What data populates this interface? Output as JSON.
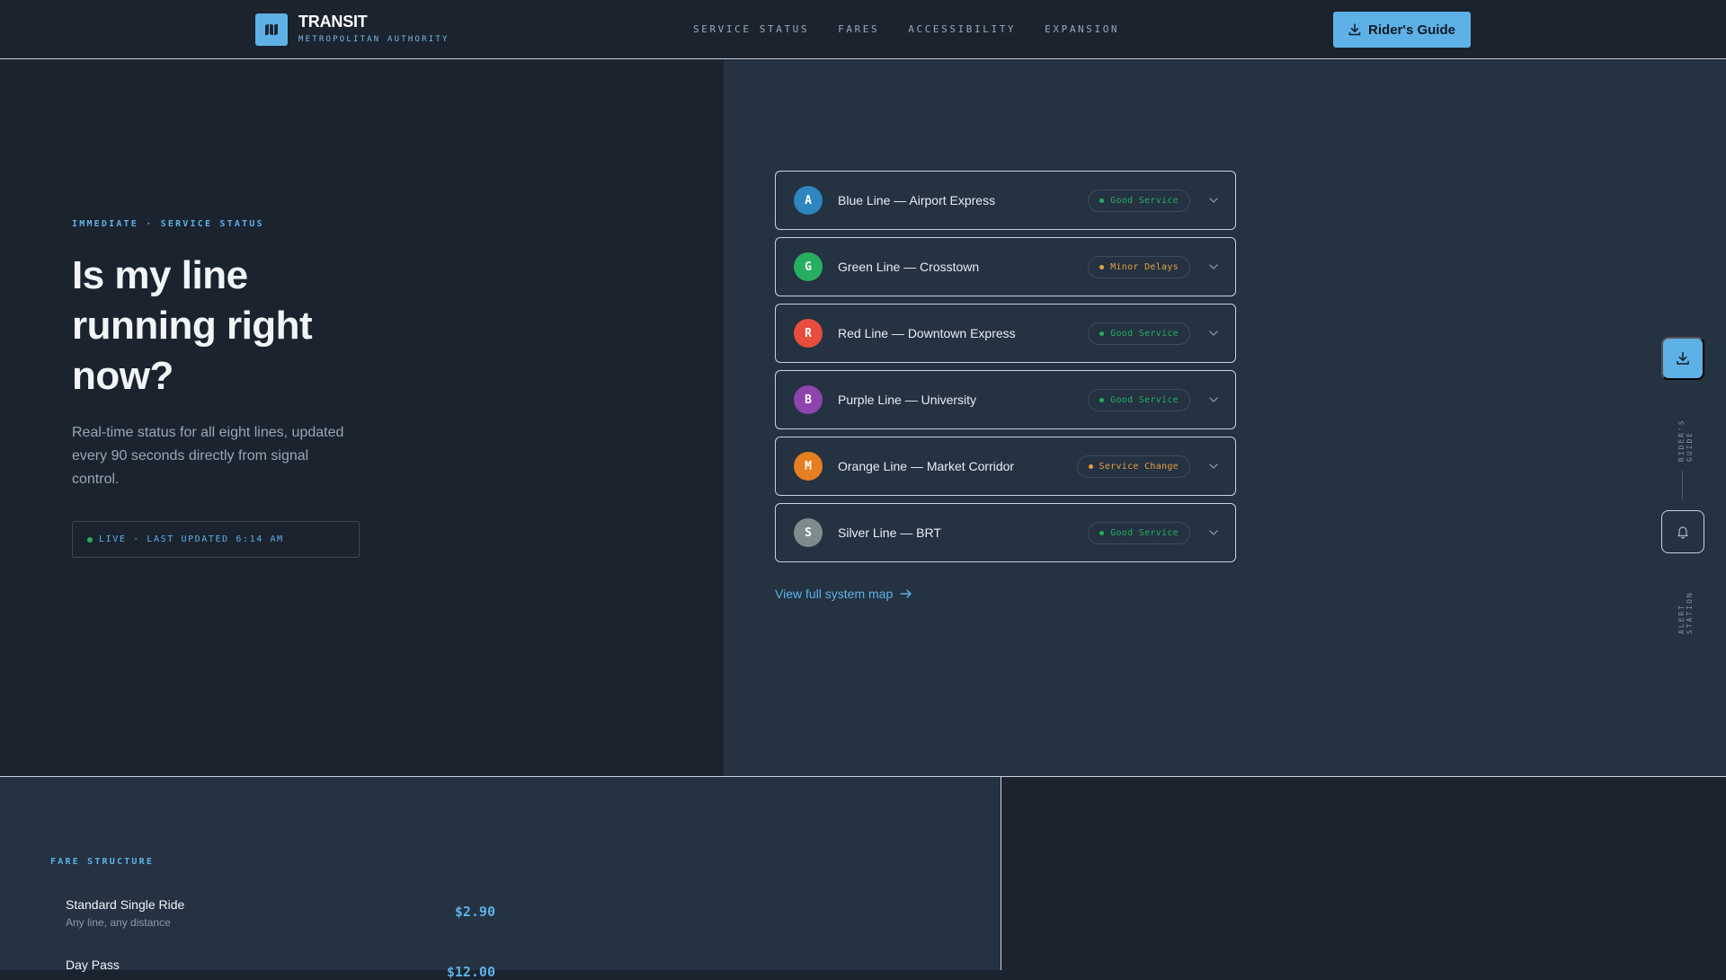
{
  "brand": {
    "name": "TRANSIT",
    "subtitle": "METROPOLITAN AUTHORITY",
    "logo_icon": "map-icon"
  },
  "nav": {
    "items": [
      "SERVICE STATUS",
      "FARES",
      "ACCESSIBILITY",
      "EXPANSION"
    ]
  },
  "header": {
    "guide_button": "Rider's Guide"
  },
  "hero": {
    "kicker": "IMMEDIATE · SERVICE STATUS",
    "title": "Is my line running right now?",
    "description": "Real-time status for all eight lines, updated every 90 seconds directly from signal control.",
    "live": "LIVE · LAST UPDATED 6:14 AM"
  },
  "lines": [
    {
      "letter": "A",
      "name": "Blue Line — Airport Express",
      "status": "Good Service",
      "color": "#2e86c1",
      "status_color": "#27ae60"
    },
    {
      "letter": "G",
      "name": "Green Line — Crosstown",
      "status": "Minor Delays",
      "color": "#27ae60",
      "status_color": "#e6a23c"
    },
    {
      "letter": "R",
      "name": "Red Line — Downtown Express",
      "status": "Good Service",
      "color": "#e74c3c",
      "status_color": "#27ae60"
    },
    {
      "letter": "B",
      "name": "Purple Line — University",
      "status": "Good Service",
      "color": "#8e44ad",
      "status_color": "#27ae60"
    },
    {
      "letter": "M",
      "name": "Orange Line — Market Corridor",
      "status": "Service Change",
      "color": "#e67e22",
      "status_color": "#e6a23c"
    },
    {
      "letter": "S",
      "name": "Silver Line — BRT",
      "status": "Good Service",
      "color": "#7f8c8d",
      "status_color": "#27ae60"
    }
  ],
  "map_link": "View full system map",
  "rail": {
    "guide_label": "RIDER'S GUIDE",
    "alert_label": "ALERT STATION"
  },
  "fares": {
    "kicker": "FARE STRUCTURE",
    "items": [
      {
        "name": "Standard Single Ride",
        "note": "Any line, any distance",
        "price": "$2.90"
      },
      {
        "name": "Day Pass",
        "note": "",
        "price": "$12.00"
      }
    ]
  },
  "colors": {
    "accent": "#5eb1e6",
    "good": "#27ae60",
    "warn": "#e6a23c"
  }
}
